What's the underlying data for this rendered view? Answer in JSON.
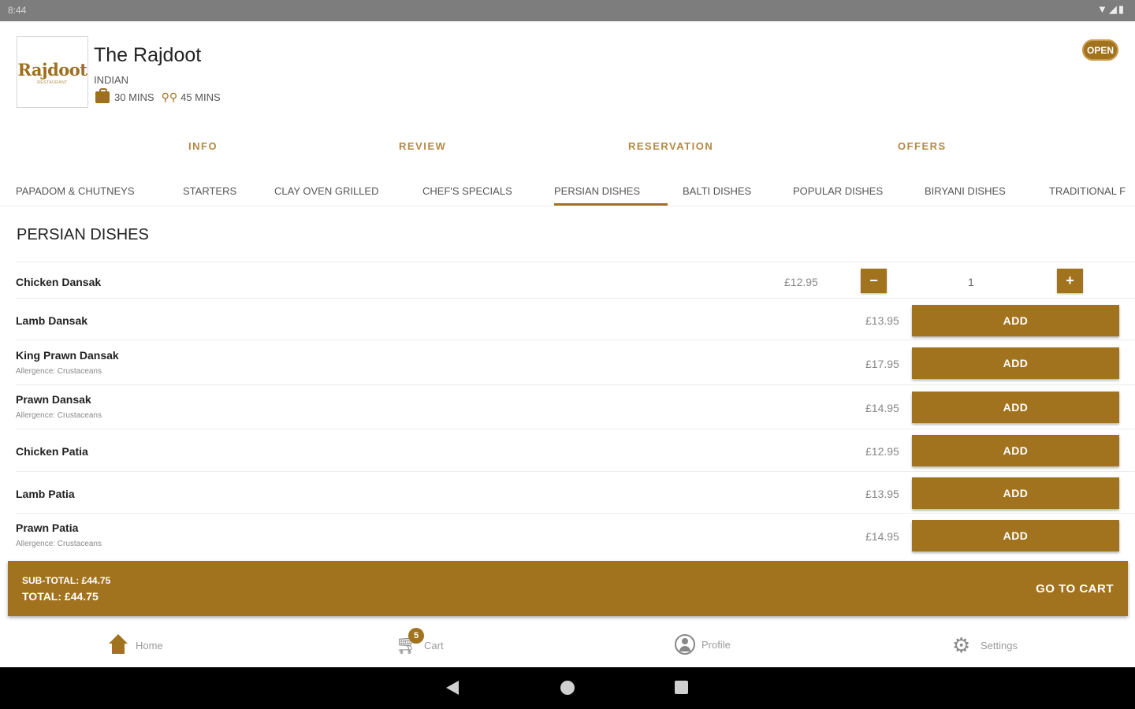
{
  "status_bar": {
    "time": "8:44",
    "icons": "▼◢▮"
  },
  "restaurant": {
    "logo_text": "Rajdoot",
    "logo_subtext": "RESTAURANT",
    "name": "The Rajdoot",
    "cuisine": "INDIAN",
    "collection_time": "30 MINS",
    "delivery_time": "45 MINS",
    "open_badge": "OPEN",
    "accent_color": "#a2731f"
  },
  "main_tabs": [
    "INFO",
    "REVIEW",
    "RESERVATION",
    "OFFERS"
  ],
  "category_tabs": {
    "items": [
      "PAPADOM & CHUTNEYS",
      "STARTERS",
      "CLAY OVEN GRILLED",
      "CHEF'S SPECIALS",
      "PERSIAN DISHES",
      "BALTI DISHES",
      "POPULAR DISHES",
      "BIRYANI DISHES",
      "TRADITIONAL F"
    ],
    "active": "PERSIAN DISHES"
  },
  "section": {
    "title": "PERSIAN DISHES",
    "items": [
      {
        "name": "Chicken Dansak",
        "allergen": "",
        "price": "£12.95",
        "quantity": "1",
        "minus": "−",
        "plus": "+"
      },
      {
        "name": "Lamb Dansak",
        "allergen": "",
        "price": "£13.95",
        "button": "ADD"
      },
      {
        "name": "King Prawn Dansak",
        "allergen": "Allergence: Crustaceans",
        "price": "£17.95",
        "button": "ADD"
      },
      {
        "name": "Prawn Dansak",
        "allergen": "Allergence: Crustaceans",
        "price": "£14.95",
        "button": "ADD"
      },
      {
        "name": "Chicken Patia",
        "allergen": "",
        "price": "£12.95",
        "button": "ADD"
      },
      {
        "name": "Lamb Patia",
        "allergen": "",
        "price": "£13.95",
        "button": "ADD"
      },
      {
        "name": "Prawn Patia",
        "allergen": "Allergence: Crustaceans",
        "price": "£14.95",
        "button": "ADD"
      }
    ]
  },
  "cart_bar": {
    "sub_total": "SUB-TOTAL: £44.75",
    "total": "TOTAL: £44.75",
    "go_to_cart": "GO TO CART"
  },
  "bottom_nav": {
    "home": "Home",
    "cart": "Cart",
    "cart_count": "5",
    "profile": "Profile",
    "settings": "Settings"
  }
}
